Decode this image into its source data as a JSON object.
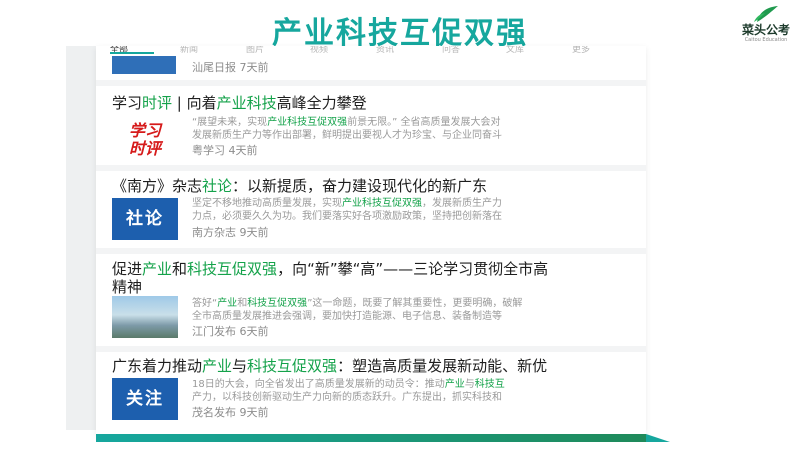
{
  "slide": {
    "title": "产业科技互促双强"
  },
  "logo": {
    "name": "菜头公考",
    "sub": "Caitou Education"
  },
  "tabs": [
    "全部",
    "新闻",
    "图片",
    "视频",
    "资讯",
    "问答",
    "文库",
    "更多"
  ],
  "first_item": {
    "meta": "汕尾日报   7天前"
  },
  "articles": [
    {
      "title_parts": [
        {
          "t": "学习"
        },
        {
          "t": "时评",
          "hl": true
        },
        {
          "t": " | 向着"
        },
        {
          "t": "产业科技",
          "hl": true
        },
        {
          "t": "高峰全力攀登"
        }
      ],
      "thumb_lines": [
        "学习",
        "时评"
      ],
      "snippet_lines": [
        [
          {
            "t": "“展望未来，实现"
          },
          {
            "t": "产业科技互促双强",
            "hl": true
          },
          {
            "t": "前景无限。” 全省高质量发展大会对"
          }
        ],
        [
          {
            "t": "发展新质生产力等作出部署，鲜明提出要视人才为珍宝、与企业同奋斗"
          }
        ]
      ],
      "meta": "粤学习   4天前"
    },
    {
      "title_parts": [
        {
          "t": "《南方》杂志"
        },
        {
          "t": "社论",
          "hl": true
        },
        {
          "t": "：以新提质，奋力建设现代化的新广东"
        }
      ],
      "thumb_label": "社论",
      "snippet_lines": [
        [
          {
            "t": "坚定不移地推动高质量发展，实现"
          },
          {
            "t": "产业科技互促双强",
            "hl": true
          },
          {
            "t": "，发展新质生产力"
          }
        ],
        [
          {
            "t": "力点，必须要久久为功。我们要落实好各项激励政策，坚持把创新落在"
          }
        ]
      ],
      "meta": "南方杂志   9天前"
    },
    {
      "title_parts": [
        {
          "t": "促进"
        },
        {
          "t": "产业",
          "hl": true
        },
        {
          "t": "和"
        },
        {
          "t": "科技互促双强",
          "hl": true
        },
        {
          "t": "，向“新”攀“高”——三论学习贯彻全市高"
        }
      ],
      "title_line2": "精神",
      "snippet_lines": [
        [
          {
            "t": "答好“"
          },
          {
            "t": "产业",
            "hl": true
          },
          {
            "t": "和"
          },
          {
            "t": "科技互促双强",
            "hl": true
          },
          {
            "t": "”这一命题，既要了解其重要性，更要明确，破解"
          }
        ],
        [
          {
            "t": "全市高质量发展推进会强调，要加快打造能源、电子信息、装备制造等"
          }
        ]
      ],
      "meta": "江门发布   6天前"
    },
    {
      "title_parts": [
        {
          "t": "广东着力推动"
        },
        {
          "t": "产业",
          "hl": true
        },
        {
          "t": "与"
        },
        {
          "t": "科技互促双强",
          "hl": true
        },
        {
          "t": "：塑造高质量发展新动能、新优"
        }
      ],
      "thumb_label": "关注",
      "snippet_lines": [
        [
          {
            "t": "18日的大会，向全省发出了高质量发展新的动员令：推动"
          },
          {
            "t": "产业",
            "hl": true
          },
          {
            "t": "与"
          },
          {
            "t": "科技互",
            "hl": true
          }
        ],
        [
          {
            "t": "产力，以科技创新驱动生产力向新的质态跃升。广东提出，抓实科技和"
          }
        ]
      ],
      "meta": "茂名发布   9天前"
    }
  ],
  "colors": {
    "accent": "#16a79e",
    "highlight": "#14a24a",
    "thumb_blue": "#1d5fae"
  }
}
